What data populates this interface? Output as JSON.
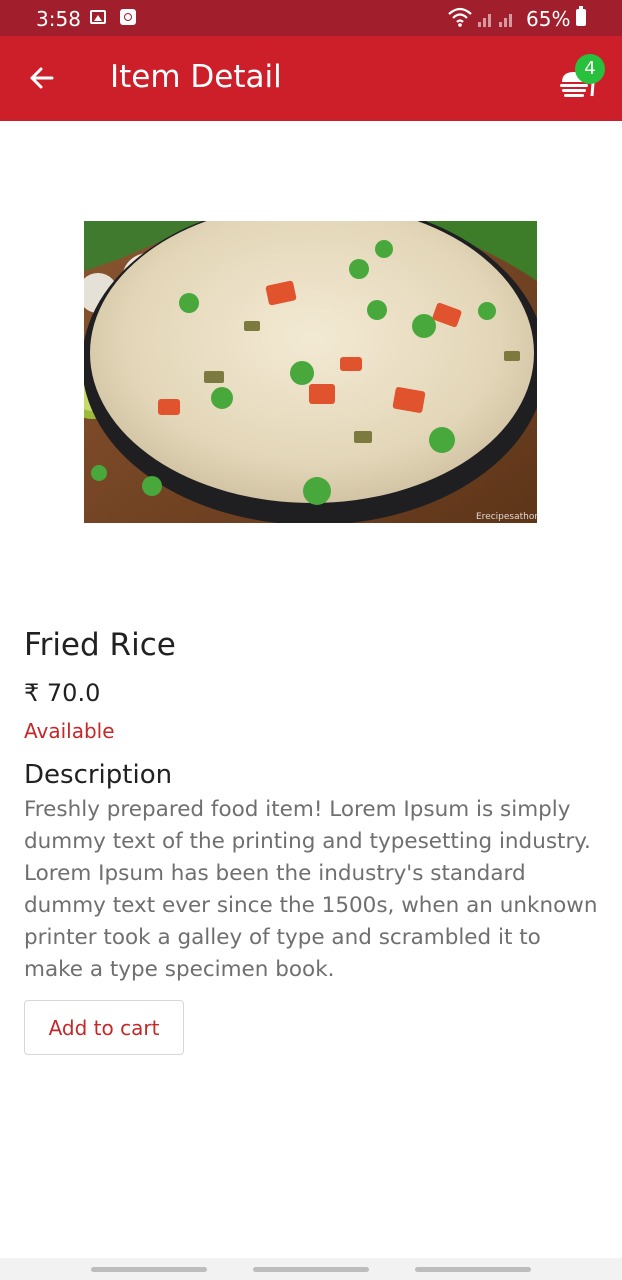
{
  "status_bar": {
    "time": "3:58",
    "battery": "65%",
    "icons": [
      "gallery-icon",
      "app-notification-icon",
      "wifi-icon",
      "signal-icon",
      "battery-icon"
    ]
  },
  "app_bar": {
    "title": "Item Detail",
    "cart_count": "4",
    "back_icon": "arrow-left-icon",
    "cart_icon": "food-cart-icon",
    "color": "#cc1f2a"
  },
  "item": {
    "image_watermark": "Erecipesathome.com",
    "name": "Fried Rice",
    "price": "₹ 70.0",
    "status": "Available",
    "description_heading": "Description",
    "description": "Freshly prepared food item! Lorem Ipsum is simply dummy text of the printing and typesetting industry. Lorem Ipsum has been the industry's standard dummy text ever since the 1500s, when an unknown printer took a galley of type and scrambled it to make a type specimen book.",
    "add_to_cart_label": "Add to cart"
  },
  "colors": {
    "status_bar": "#a11f2c",
    "accent": "#c62828",
    "badge": "#27c13d"
  }
}
